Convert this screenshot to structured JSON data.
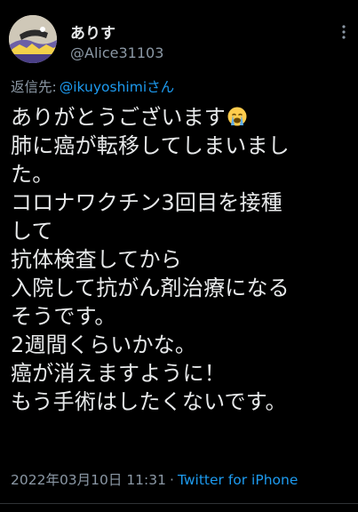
{
  "colors": {
    "background": "#000000",
    "text": "#e7e9ea",
    "secondary_text": "#8b98a5",
    "link": "#1d9bf0"
  },
  "user": {
    "display_name": "ありす",
    "handle": "@Alice31103",
    "avatar_icon": "avatar-icon"
  },
  "more_icon": "more-dots-icon",
  "reply": {
    "prefix": "返信先:",
    "mention": "@ikuyoshimiさん"
  },
  "tweet": {
    "lines": [
      "ありがとうございます",
      "肺に癌が転移してしまいまし",
      "た。",
      "コロナワクチン3回目を接種",
      "して",
      "抗体検査してから",
      "入院して抗がん剤治療になる",
      "そうです。",
      "2週間くらいかな。",
      "癌が消えますように！",
      "もう手術はしたくないです。"
    ],
    "emoji": "loudly-crying-face-icon"
  },
  "meta": {
    "timestamp": "2022年03月10日 11:31",
    "separator": "·",
    "source": "Twitter for iPhone"
  }
}
